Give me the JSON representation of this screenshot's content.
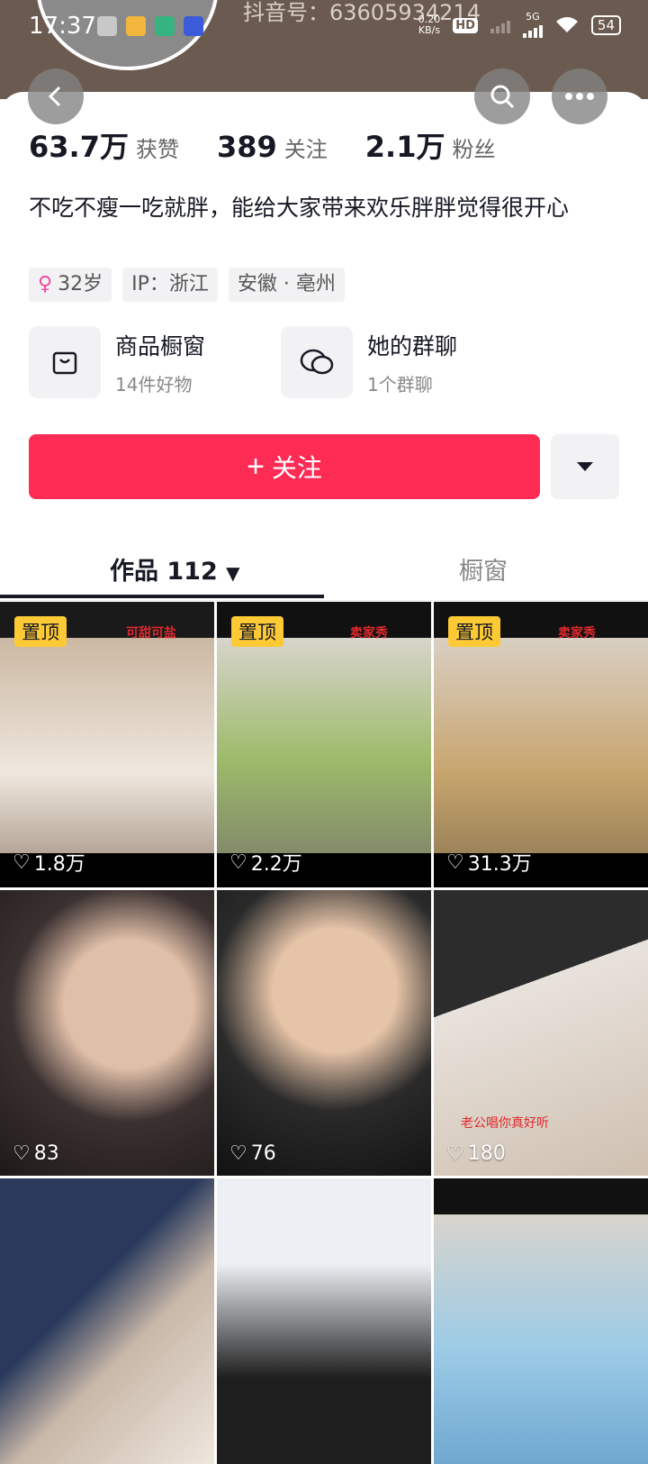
{
  "status_bar": {
    "time": "17:37",
    "net_speed": "0.20\nKB/s",
    "hd": "HD",
    "network": "5G",
    "battery": "54"
  },
  "profile": {
    "douyin_id_partial": "抖音号：63605934214",
    "likes_count": "63.7万",
    "likes_label": "获赞",
    "following_count": "389",
    "following_label": "关注",
    "followers_count": "2.1万",
    "followers_label": "粉丝",
    "bio": "不吃不瘦一吃就胖，能给大家带来欢乐胖胖觉得很开心",
    "tags": {
      "age": "32岁",
      "ip": "IP：浙江",
      "location": "安徽 · 亳州"
    },
    "features": [
      {
        "title": "商品橱窗",
        "subtitle": "14件好物",
        "icon": "shopping-bag-icon"
      },
      {
        "title": "她的群聊",
        "subtitle": "1个群聊",
        "icon": "chat-bubbles-icon"
      }
    ],
    "follow_button": "关注",
    "accent_color": "#fe2c55"
  },
  "tabs": {
    "works": "作品 112",
    "showcase": "橱窗"
  },
  "grid": {
    "pinned_label": "置顶",
    "items": [
      {
        "likes": "1.8万",
        "pinned": true,
        "overlay": "可甜可盐"
      },
      {
        "likes": "2.2万",
        "pinned": true,
        "overlay": "卖家秀"
      },
      {
        "likes": "31.3万",
        "pinned": true,
        "overlay": "卖家秀"
      },
      {
        "likes": "83",
        "pinned": false,
        "overlay": ""
      },
      {
        "likes": "76",
        "pinned": false,
        "overlay": ""
      },
      {
        "likes": "180",
        "pinned": false,
        "overlay": "老公唱你真好听"
      },
      {
        "likes": "",
        "pinned": false,
        "overlay": ""
      },
      {
        "likes": "",
        "pinned": false,
        "overlay": ""
      },
      {
        "likes": "",
        "pinned": false,
        "overlay": ""
      }
    ]
  }
}
